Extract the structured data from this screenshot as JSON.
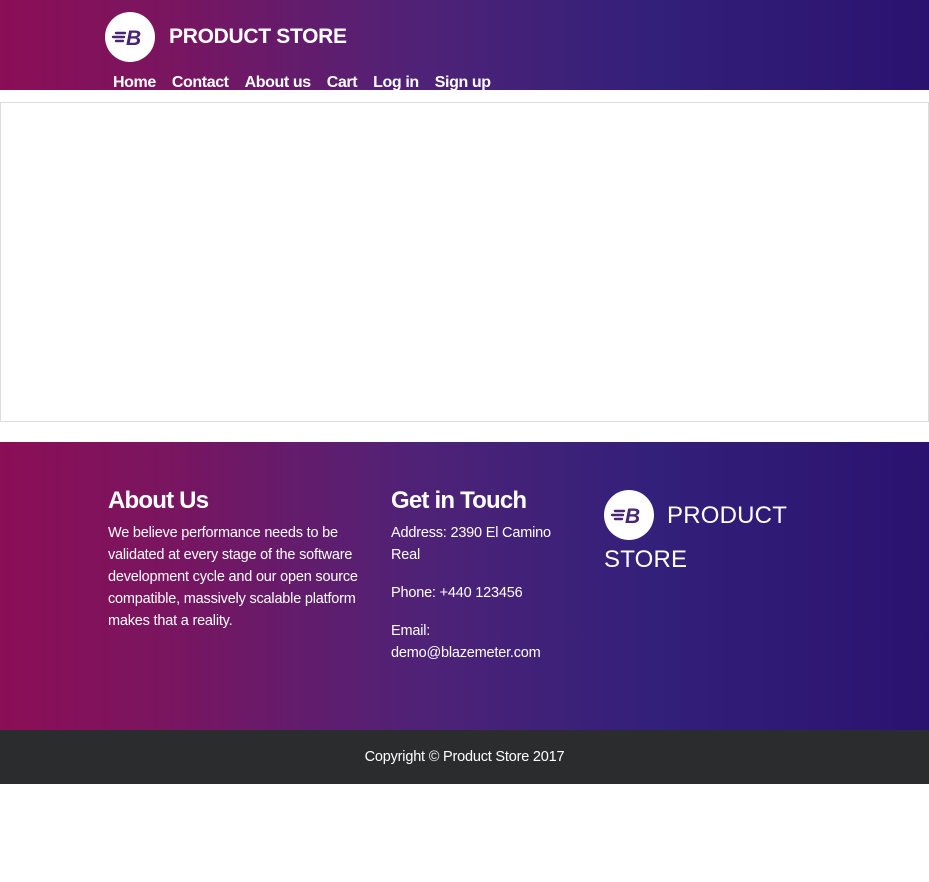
{
  "brand": {
    "logo_icon": "blazemeter-b-logo-icon",
    "name": "PRODUCT STORE"
  },
  "nav": {
    "items": [
      {
        "label": "Home"
      },
      {
        "label": "Contact"
      },
      {
        "label": "About us"
      },
      {
        "label": "Cart"
      },
      {
        "label": "Log in"
      },
      {
        "label": "Sign up"
      }
    ]
  },
  "footer": {
    "about": {
      "title": "About Us",
      "text": "We believe performance needs to be validated at every stage of the software development cycle and our open source compatible, massively scalable platform makes that a reality."
    },
    "touch": {
      "title": "Get in Touch",
      "address": "Address: 2390 El Camino Real",
      "phone": "Phone: +440 123456",
      "email_label": "Email:",
      "email": "demo@blazemeter.com"
    },
    "brand": {
      "word1": "PRODUCT",
      "word2": "STORE"
    },
    "copyright": "Copyright © Product Store 2017"
  },
  "colors": {
    "gradient_start": "#8b0e56",
    "gradient_end": "#2a1370",
    "logo_fill": "#4a2475",
    "copyright_bg": "#2b2c2e"
  }
}
